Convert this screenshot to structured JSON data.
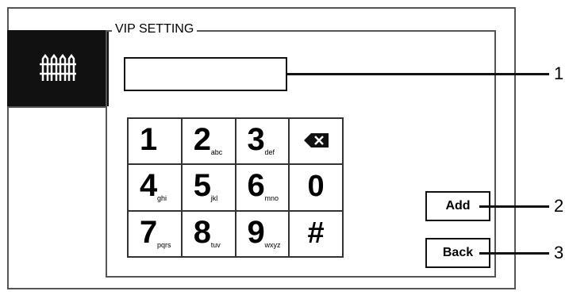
{
  "group_title": "VIP SETTING",
  "sidebar_icon": "fence-icon",
  "input": {
    "value": ""
  },
  "keypad": [
    {
      "main": "1",
      "sub": ""
    },
    {
      "main": "2",
      "sub": "abc"
    },
    {
      "main": "3",
      "sub": "def"
    },
    {
      "main": "⌫",
      "sub": "",
      "icon": "backspace-icon"
    },
    {
      "main": "4",
      "sub": "ghi"
    },
    {
      "main": "5",
      "sub": "jkl"
    },
    {
      "main": "6",
      "sub": "mno"
    },
    {
      "main": "0",
      "sub": ""
    },
    {
      "main": "7",
      "sub": "pqrs"
    },
    {
      "main": "8",
      "sub": "tuv"
    },
    {
      "main": "9",
      "sub": "wxyz"
    },
    {
      "main": "#",
      "sub": ""
    }
  ],
  "buttons": {
    "add": "Add",
    "back": "Back"
  },
  "callouts": [
    "1",
    "2",
    "3"
  ]
}
